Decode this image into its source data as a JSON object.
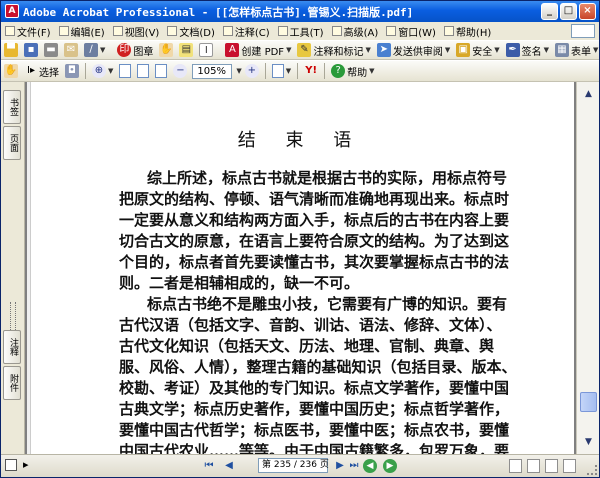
{
  "window": {
    "title": "Adobe Acrobat Professional - [[怎样标点古书].管锡义.扫描版.pdf]",
    "controls": [
      "_",
      "□",
      "×"
    ]
  },
  "menu": {
    "items": [
      "文件(F)",
      "编辑(E)",
      "视图(V)",
      "文档(D)",
      "注释(C)",
      "工具(T)",
      "高级(A)",
      "窗口(W)",
      "帮助(H)"
    ]
  },
  "toolbar1": {
    "tu_zhang": "图章",
    "create_pdf": "创建 PDF",
    "comment_markup": "注释和标记",
    "send_review": "发送供审阅",
    "security": "安全",
    "sign": "签名",
    "forms": "表单"
  },
  "toolbar2": {
    "select": "选择",
    "zoom_value": "105%",
    "help": "帮助"
  },
  "nav_tabs": {
    "top1": "书签",
    "top2": "页面",
    "bottom1": "注释",
    "bottom2": "附件"
  },
  "document": {
    "heading": "结 束 语",
    "lines": [
      "综上所述，标点古书就是根据古书的实际，用标点符号",
      "把原文的结构、停顿、语气清晰而准确地再现出来。标点时",
      "一定要从意义和结构两方面入手，标点后的古书在内容上要",
      "切合古文的原意，在语言上要符合原文的结构。为了达到这",
      "个目的，标点者首先要读懂古书，其次要掌握标点古书的法",
      "则。二者是相辅相成的，缺一不可。",
      "标点古书绝不是雕虫小技，它需要有广博的知识。要有",
      "古代汉语（包括文字、音韵、训诂、语法、修辞、文体）、",
      "古代文化知识（包括天文、历法、地理、官制、典章、舆",
      "服、风俗、人情），整理古籍的基础知识（包括目录、版本、",
      "校勘、考证）及其他的专门知识。标点文学著作，要懂中国",
      "古典文学；标点历史著作，要懂中国历史；标点哲学著作，",
      "要懂中国古代哲学；标点医书，要懂中医；标点农书，要懂",
      "中国古代农业……等等。由于中国古籍繁多，包罗万象，要"
    ]
  },
  "status": {
    "page_display": "第 235 / 236 页"
  }
}
